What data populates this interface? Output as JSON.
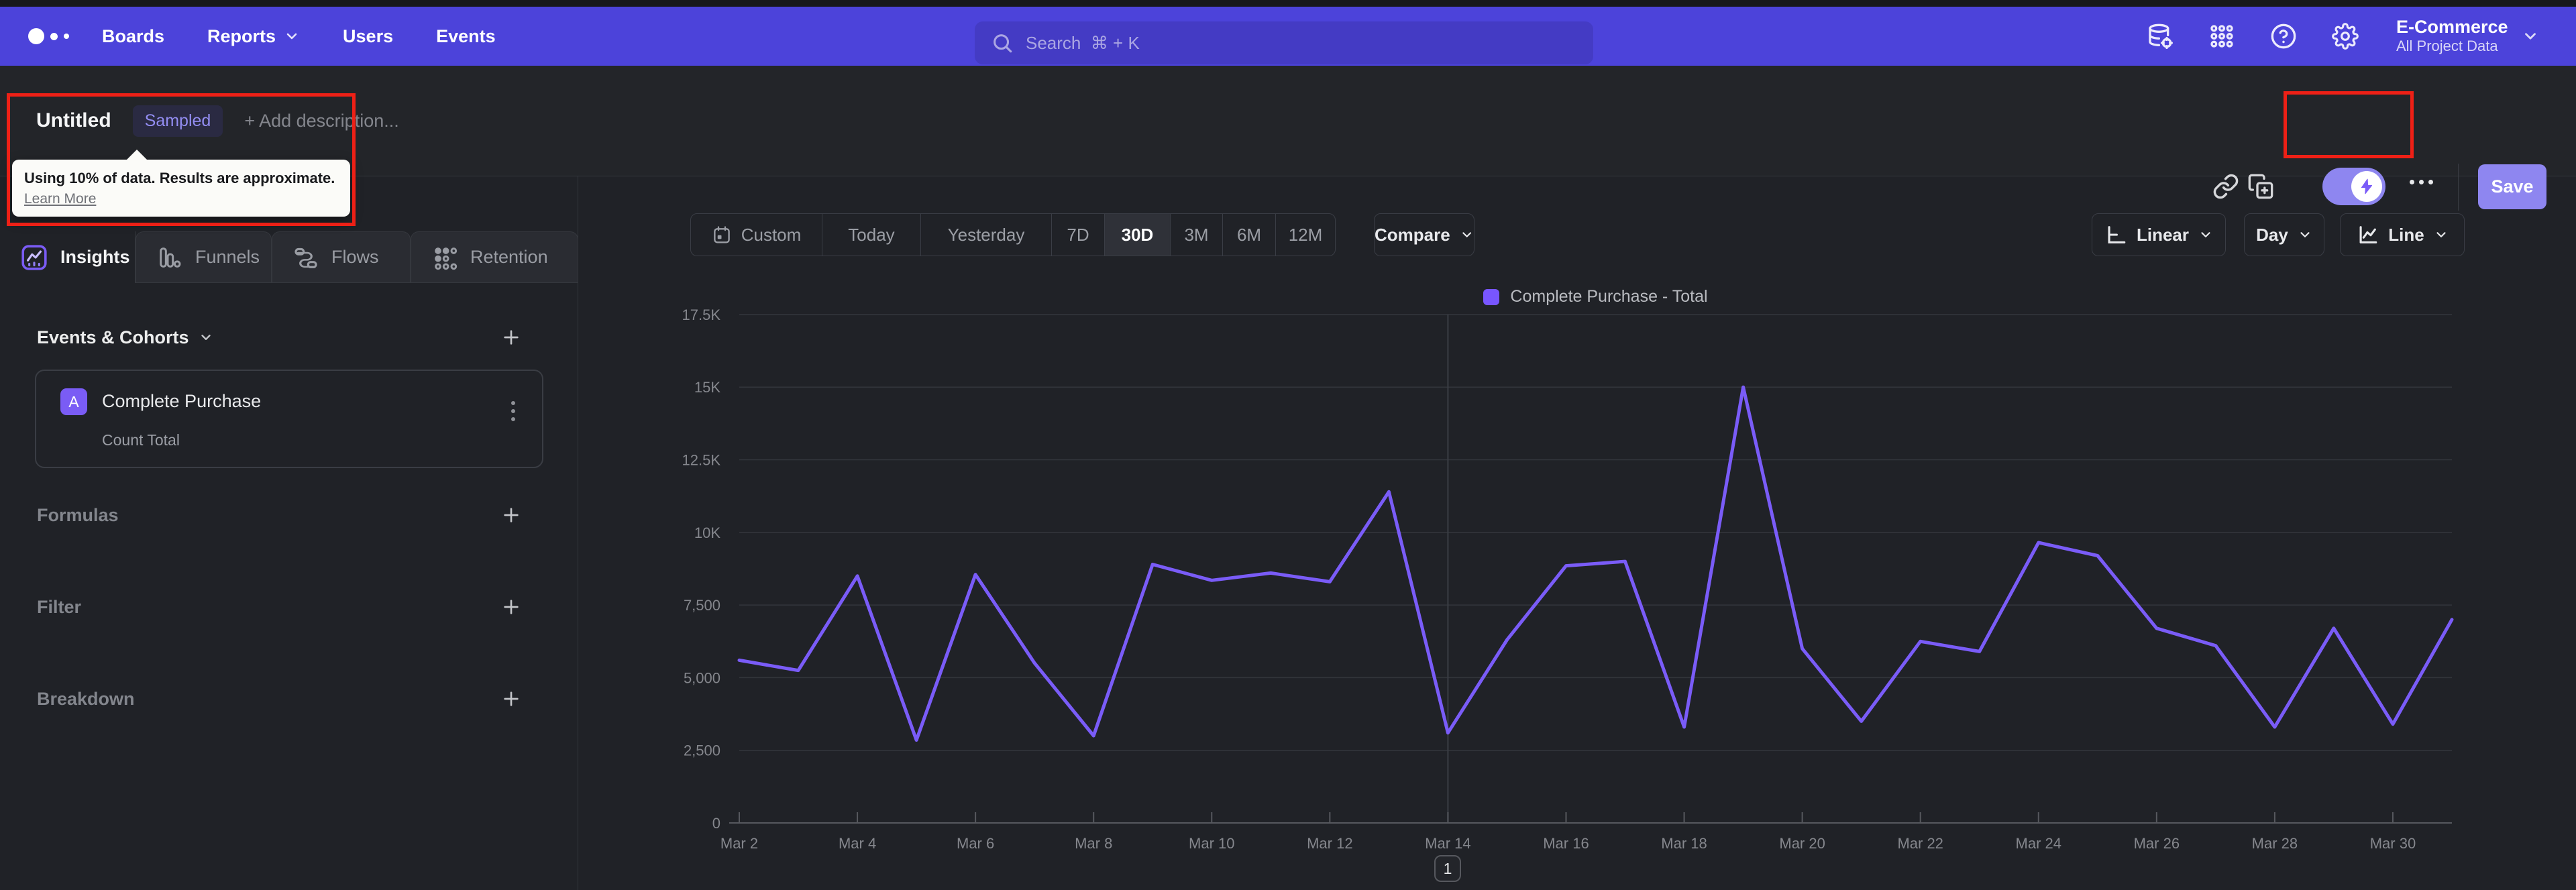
{
  "nav": {
    "links": [
      "Boards",
      "Reports",
      "Users",
      "Events"
    ],
    "search_placeholder": "Search  ⌘ + K",
    "project_name": "E-Commerce",
    "project_scope": "All Project Data"
  },
  "header": {
    "title": "Untitled",
    "badge": "Sampled",
    "add_description": "+ Add description...",
    "save_label": "Save"
  },
  "tooltip": {
    "line1": "Using 10% of data. Results are approximate.",
    "link": "Learn More"
  },
  "tabs": [
    {
      "label": "Insights",
      "active": true
    },
    {
      "label": "Funnels",
      "active": false
    },
    {
      "label": "Flows",
      "active": false
    },
    {
      "label": "Retention",
      "active": false
    }
  ],
  "sidebar": {
    "events_header": "Events & Cohorts",
    "event_card": {
      "letter": "A",
      "title": "Complete Purchase",
      "subtitle": "Count Total"
    },
    "rows": [
      "Formulas",
      "Filter",
      "Breakdown"
    ]
  },
  "controls": {
    "ranges": [
      "Custom",
      "Today",
      "Yesterday",
      "7D",
      "30D",
      "3M",
      "6M",
      "12M"
    ],
    "active_range": "30D",
    "compare": "Compare",
    "scale": "Linear",
    "interval": "Day",
    "chart_type": "Line"
  },
  "legend": {
    "label": "Complete Purchase - Total",
    "color": "#7856ff"
  },
  "pagination": "1",
  "chart_data": {
    "type": "line",
    "title": "Complete Purchase - Total",
    "x": [
      "Mar 2",
      "Mar 3",
      "Mar 4",
      "Mar 5",
      "Mar 6",
      "Mar 7",
      "Mar 8",
      "Mar 9",
      "Mar 10",
      "Mar 11",
      "Mar 12",
      "Mar 13",
      "Mar 14",
      "Mar 15",
      "Mar 16",
      "Mar 17",
      "Mar 18",
      "Mar 19",
      "Mar 20",
      "Mar 21",
      "Mar 22",
      "Mar 23",
      "Mar 24",
      "Mar 25",
      "Mar 26",
      "Mar 27",
      "Mar 28",
      "Mar 29",
      "Mar 30",
      "Mar 31"
    ],
    "values": [
      5600,
      5250,
      8500,
      2850,
      8550,
      5500,
      3000,
      8900,
      8350,
      8600,
      8300,
      11400,
      3100,
      6300,
      8850,
      9000,
      3300,
      15000,
      6000,
      3500,
      6250,
      5900,
      9650,
      9200,
      6700,
      6100,
      3300,
      6700,
      3400,
      7000
    ],
    "y_ticks": [
      "0",
      "2,500",
      "5,000",
      "7,500",
      "10K",
      "12.5K",
      "15K",
      "17.5K"
    ],
    "x_tick_labels": [
      "Mar 2",
      "Mar 4",
      "Mar 6",
      "Mar 8",
      "Mar 10",
      "Mar 12",
      "Mar 14",
      "Mar 16",
      "Mar 18",
      "Mar 20",
      "Mar 22",
      "Mar 24",
      "Mar 26",
      "Mar 28",
      "Mar 30"
    ],
    "ylim": [
      0,
      17500
    ],
    "grid": true,
    "legend_position": "top-center",
    "series_color": "#7a5cf8",
    "vertical_gridline_x": "Mar 14"
  },
  "colors": {
    "nav_purple": "#4c43da",
    "accent_purple": "#7a5cf8",
    "control_purple": "#8e86f0",
    "annotation_red": "#ee2016",
    "background": "#202227"
  }
}
